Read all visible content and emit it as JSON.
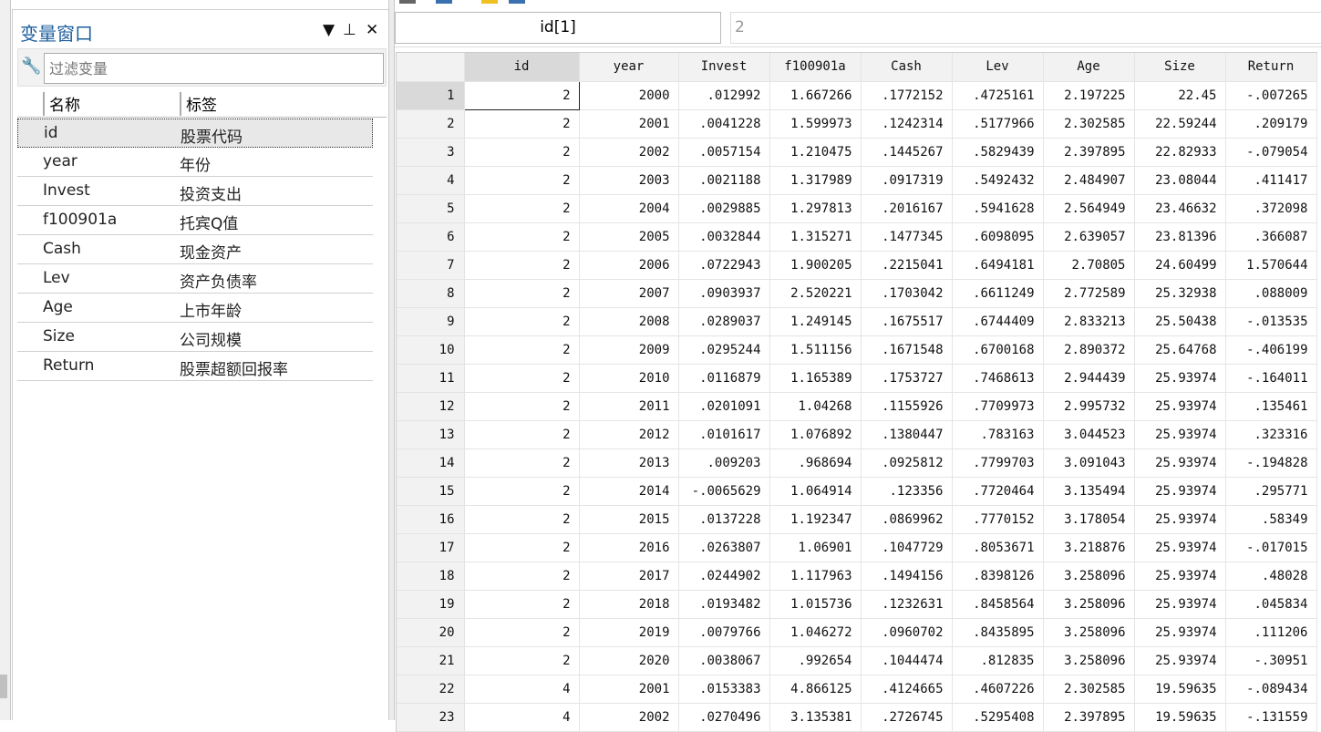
{
  "var_panel": {
    "title": "变量窗口",
    "filter_placeholder": "过滤变量",
    "col_name": "名称",
    "col_label": "标签",
    "variables": [
      {
        "name": "id",
        "label": "股票代码"
      },
      {
        "name": "year",
        "label": "年份"
      },
      {
        "name": "Invest",
        "label": "投资支出"
      },
      {
        "name": "f100901a",
        "label": "托宾Q值"
      },
      {
        "name": "Cash",
        "label": "现金资产"
      },
      {
        "name": "Lev",
        "label": "资产负债率"
      },
      {
        "name": "Age",
        "label": "上市年龄"
      },
      {
        "name": "Size",
        "label": "公司规模"
      },
      {
        "name": "Return",
        "label": "股票超额回报率"
      }
    ]
  },
  "cell_bar": {
    "name": "id[1]",
    "value": "2"
  },
  "columns": [
    "id",
    "year",
    "Invest",
    "f100901a",
    "Cash",
    "Lev",
    "Age",
    "Size",
    "Return"
  ],
  "rows": [
    [
      "1",
      "2",
      "2000",
      ".012992",
      "1.667266",
      ".1772152",
      ".4725161",
      "2.197225",
      "22.45",
      "-.007265"
    ],
    [
      "2",
      "2",
      "2001",
      ".0041228",
      "1.599973",
      ".1242314",
      ".5177966",
      "2.302585",
      "22.59244",
      ".209179"
    ],
    [
      "3",
      "2",
      "2002",
      ".0057154",
      "1.210475",
      ".1445267",
      ".5829439",
      "2.397895",
      "22.82933",
      "-.079054"
    ],
    [
      "4",
      "2",
      "2003",
      ".0021188",
      "1.317989",
      ".0917319",
      ".5492432",
      "2.484907",
      "23.08044",
      ".411417"
    ],
    [
      "5",
      "2",
      "2004",
      ".0029885",
      "1.297813",
      ".2016167",
      ".5941628",
      "2.564949",
      "23.46632",
      ".372098"
    ],
    [
      "6",
      "2",
      "2005",
      ".0032844",
      "1.315271",
      ".1477345",
      ".6098095",
      "2.639057",
      "23.81396",
      ".366087"
    ],
    [
      "7",
      "2",
      "2006",
      ".0722943",
      "1.900205",
      ".2215041",
      ".6494181",
      "2.70805",
      "24.60499",
      "1.570644"
    ],
    [
      "8",
      "2",
      "2007",
      ".0903937",
      "2.520221",
      ".1703042",
      ".6611249",
      "2.772589",
      "25.32938",
      ".088009"
    ],
    [
      "9",
      "2",
      "2008",
      ".0289037",
      "1.249145",
      ".1675517",
      ".6744409",
      "2.833213",
      "25.50438",
      "-.013535"
    ],
    [
      "10",
      "2",
      "2009",
      ".0295244",
      "1.511156",
      ".1671548",
      ".6700168",
      "2.890372",
      "25.64768",
      "-.406199"
    ],
    [
      "11",
      "2",
      "2010",
      ".0116879",
      "1.165389",
      ".1753727",
      ".7468613",
      "2.944439",
      "25.93974",
      "-.164011"
    ],
    [
      "12",
      "2",
      "2011",
      ".0201091",
      "1.04268",
      ".1155926",
      ".7709973",
      "2.995732",
      "25.93974",
      ".135461"
    ],
    [
      "13",
      "2",
      "2012",
      ".0101617",
      "1.076892",
      ".1380447",
      ".783163",
      "3.044523",
      "25.93974",
      ".323316"
    ],
    [
      "14",
      "2",
      "2013",
      ".009203",
      ".968694",
      ".0925812",
      ".7799703",
      "3.091043",
      "25.93974",
      "-.194828"
    ],
    [
      "15",
      "2",
      "2014",
      "-.0065629",
      "1.064914",
      ".123356",
      ".7720464",
      "3.135494",
      "25.93974",
      ".295771"
    ],
    [
      "16",
      "2",
      "2015",
      ".0137228",
      "1.192347",
      ".0869962",
      ".7770152",
      "3.178054",
      "25.93974",
      ".58349"
    ],
    [
      "17",
      "2",
      "2016",
      ".0263807",
      "1.06901",
      ".1047729",
      ".8053671",
      "3.218876",
      "25.93974",
      "-.017015"
    ],
    [
      "18",
      "2",
      "2017",
      ".0244902",
      "1.117963",
      ".1494156",
      ".8398126",
      "3.258096",
      "25.93974",
      ".48028"
    ],
    [
      "19",
      "2",
      "2018",
      ".0193482",
      "1.015736",
      ".1232631",
      ".8458564",
      "3.258096",
      "25.93974",
      ".045834"
    ],
    [
      "20",
      "2",
      "2019",
      ".0079766",
      "1.046272",
      ".0960702",
      ".8435895",
      "3.258096",
      "25.93974",
      ".111206"
    ],
    [
      "21",
      "2",
      "2020",
      ".0038067",
      ".992654",
      ".1044474",
      ".812835",
      "3.258096",
      "25.93974",
      "-.30951"
    ],
    [
      "22",
      "4",
      "2001",
      ".0153383",
      "4.866125",
      ".4124665",
      ".4607226",
      "2.302585",
      "19.59635",
      "-.089434"
    ],
    [
      "23",
      "4",
      "2002",
      ".0270496",
      "3.135381",
      ".2726745",
      ".5295408",
      "2.397895",
      "19.59635",
      "-.131559"
    ]
  ]
}
